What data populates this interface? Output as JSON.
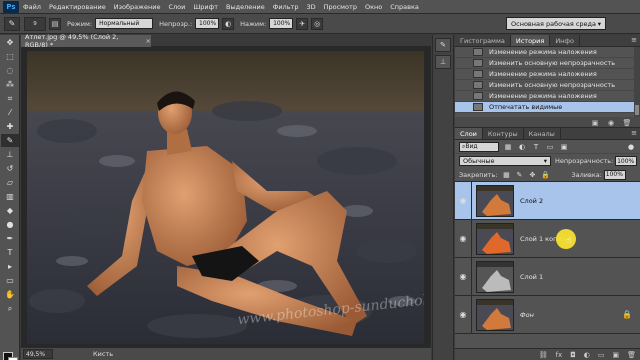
{
  "app": {
    "logo": "Ps",
    "menu": [
      "Файл",
      "Редактирование",
      "Изображение",
      "Слои",
      "Шрифт",
      "Выделение",
      "Фильтр",
      "3D",
      "Просмотр",
      "Окно",
      "Справка"
    ]
  },
  "options": {
    "brush_size": "9",
    "mode_label": "Режим:",
    "mode_value": "Нормальный",
    "opacity_label": "Непрозр.:",
    "opacity_value": "100%",
    "flow_label": "Нажим:",
    "flow_value": "100%",
    "workspace": "Основная рабочая среда"
  },
  "document": {
    "tab_title": "Атлет.jpg @ 49,5% (Слой 2, RGB/8) *",
    "close_glyph": "×",
    "zoom": "49,5%",
    "status_tool": "Кисть"
  },
  "history_panel": {
    "tabs": [
      "Гистограмма",
      "История",
      "Инфо"
    ],
    "active_tab": 1,
    "items": [
      "Изменение режима наложения",
      "Изменить основную непрозрачность",
      "Изменение режима наложения",
      "Изменить основную непрозрачность",
      "Изменение режима наложения",
      "Отпечатать видимые"
    ],
    "selected_index": 5
  },
  "layers_panel": {
    "tabs": [
      "Слои",
      "Контуры",
      "Каналы"
    ],
    "active_tab": 0,
    "filter_kind": "Вид",
    "blend_mode": "Обычные",
    "opacity_label": "Непрозрачность:",
    "opacity_value": "100%",
    "lock_label": "Закрепить:",
    "fill_label": "Заливка:",
    "fill_value": "100%",
    "layers": [
      {
        "name": "Слой 2",
        "selected": true,
        "thumb": "orange"
      },
      {
        "name": "Слой 1 копия",
        "selected": false,
        "thumb": "orange"
      },
      {
        "name": "Слой 1",
        "selected": false,
        "thumb": "gray"
      },
      {
        "name": "Фон",
        "selected": false,
        "thumb": "orange",
        "locked": true
      }
    ]
  },
  "watermark": "www.photoshop-sunduchok.ru",
  "colors": {
    "accent_selection": "#a8c4ea",
    "cursor_highlight": "#f5e030",
    "panel_bg": "#535353"
  }
}
